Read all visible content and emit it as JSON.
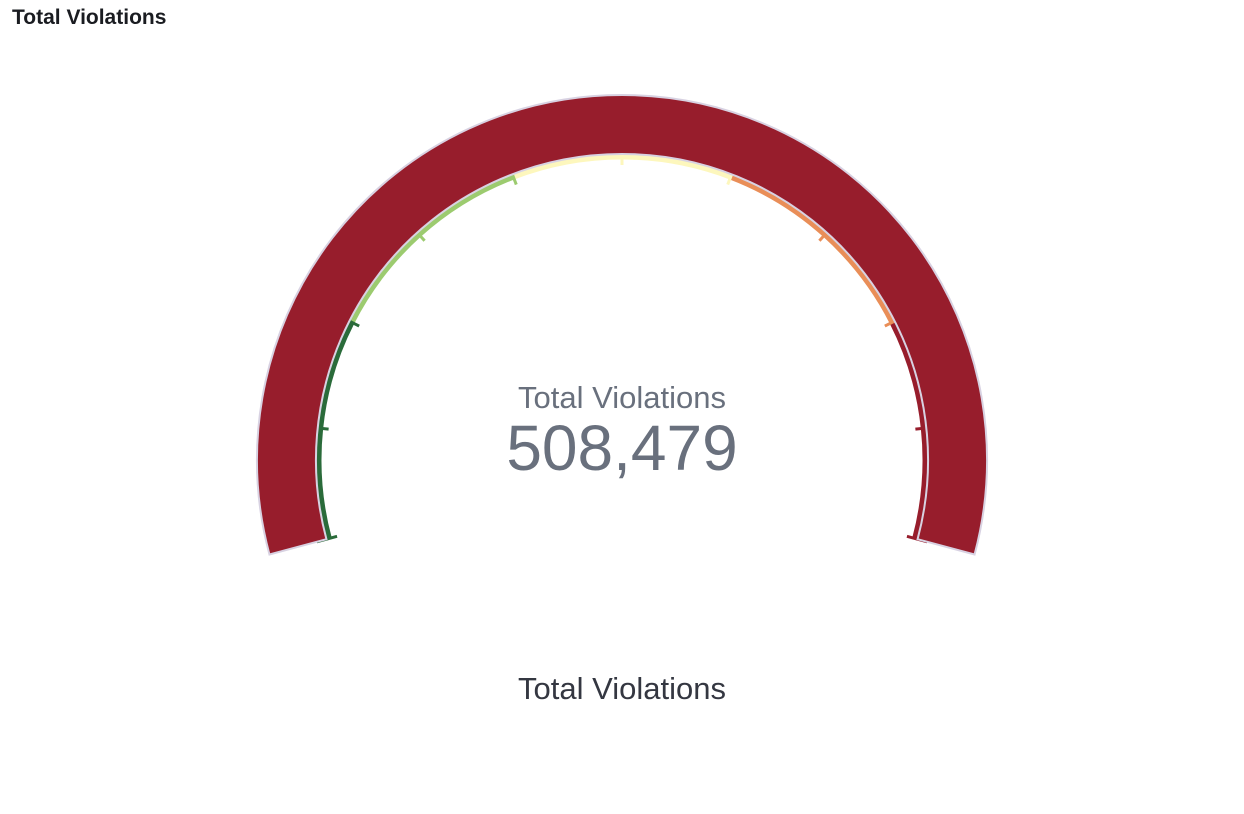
{
  "panel": {
    "title": "Total Violations"
  },
  "chart_data": {
    "type": "gauge",
    "metric_label": "Total Violations",
    "value": 508479,
    "value_display": "508,479",
    "caption": "Total Violations",
    "range": [
      0,
      10
    ],
    "fill_fraction": 1.0,
    "colors": {
      "fill": "#971d2c",
      "fill_outline": "#d8d2e2",
      "value_text": "#69707d",
      "caption_text": "#343741"
    },
    "color_bands": [
      {
        "from": 0,
        "to": 1,
        "color": "#2a6b3a"
      },
      {
        "from": 1,
        "to": 2,
        "color": "#2a6b3a"
      },
      {
        "from": 2,
        "to": 3,
        "color": "#9ccb6f"
      },
      {
        "from": 3,
        "to": 4,
        "color": "#9ccb6f"
      },
      {
        "from": 4,
        "to": 5,
        "color": "#fdf7bd"
      },
      {
        "from": 5,
        "to": 6,
        "color": "#fdf7bd"
      },
      {
        "from": 6,
        "to": 7,
        "color": "#e98e58"
      },
      {
        "from": 7,
        "to": 8,
        "color": "#e98e58"
      },
      {
        "from": 8,
        "to": 9,
        "color": "#971d2c"
      },
      {
        "from": 9,
        "to": 10,
        "color": "#971d2c"
      }
    ]
  }
}
